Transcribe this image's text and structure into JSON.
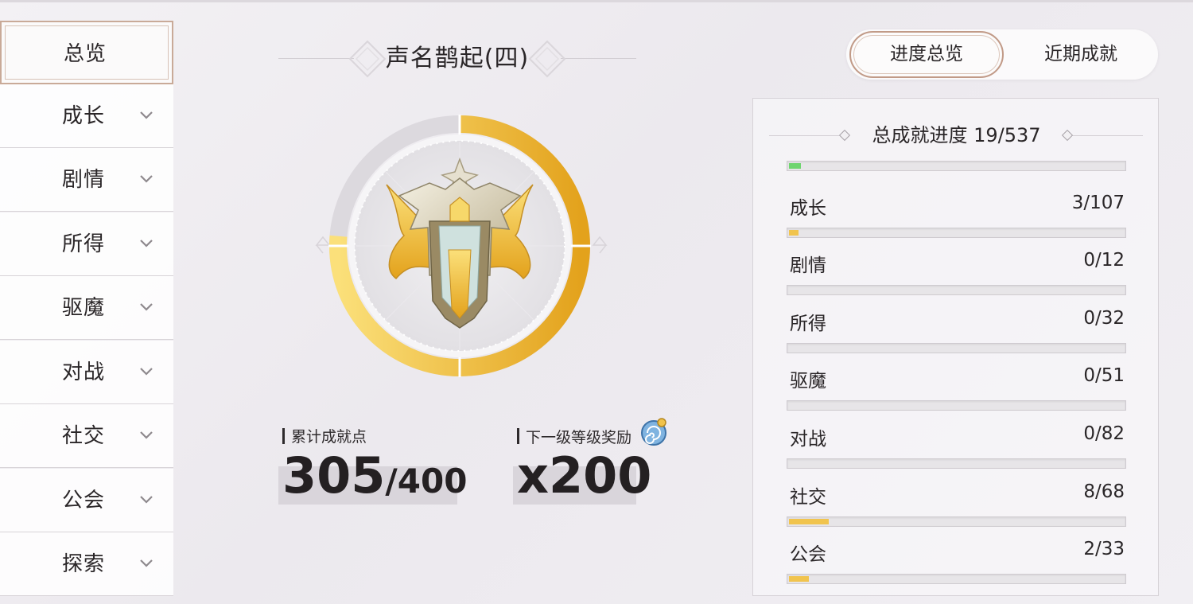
{
  "sidebar": {
    "items": [
      {
        "label": "总览",
        "active": true
      },
      {
        "label": "成长"
      },
      {
        "label": "剧情"
      },
      {
        "label": "所得"
      },
      {
        "label": "驱魔"
      },
      {
        "label": "对战"
      },
      {
        "label": "社交"
      },
      {
        "label": "公会"
      },
      {
        "label": "探索"
      }
    ]
  },
  "center": {
    "title": "声名鹊起(四)",
    "ring_progress": 0.7625,
    "points": {
      "label": "累计成就点",
      "current": "305",
      "max": "/400"
    },
    "reward": {
      "label": "下一级等级奖励",
      "amount": "x200",
      "icon": "spiral-shell-icon"
    }
  },
  "tabs": [
    {
      "label": "进度总览",
      "active": true
    },
    {
      "label": "近期成就"
    }
  ],
  "panel": {
    "title": "总成就进度 19/537",
    "total_progress": 0.035,
    "rows": [
      {
        "label": "成长",
        "value": "3/107",
        "progress": 0.028,
        "color": "#f1c44e"
      },
      {
        "label": "剧情",
        "value": "0/12",
        "progress": 0,
        "color": "#f1c44e"
      },
      {
        "label": "所得",
        "value": "0/32",
        "progress": 0,
        "color": "#f1c44e"
      },
      {
        "label": "驱魔",
        "value": "0/51",
        "progress": 0,
        "color": "#f1c44e"
      },
      {
        "label": "对战",
        "value": "0/82",
        "progress": 0,
        "color": "#f1c44e"
      },
      {
        "label": "社交",
        "value": "8/68",
        "progress": 0.118,
        "color": "#f1c44e"
      },
      {
        "label": "公会",
        "value": "2/33",
        "progress": 0.06,
        "color": "#f1c44e"
      }
    ],
    "total_color": "#6fd56f"
  }
}
